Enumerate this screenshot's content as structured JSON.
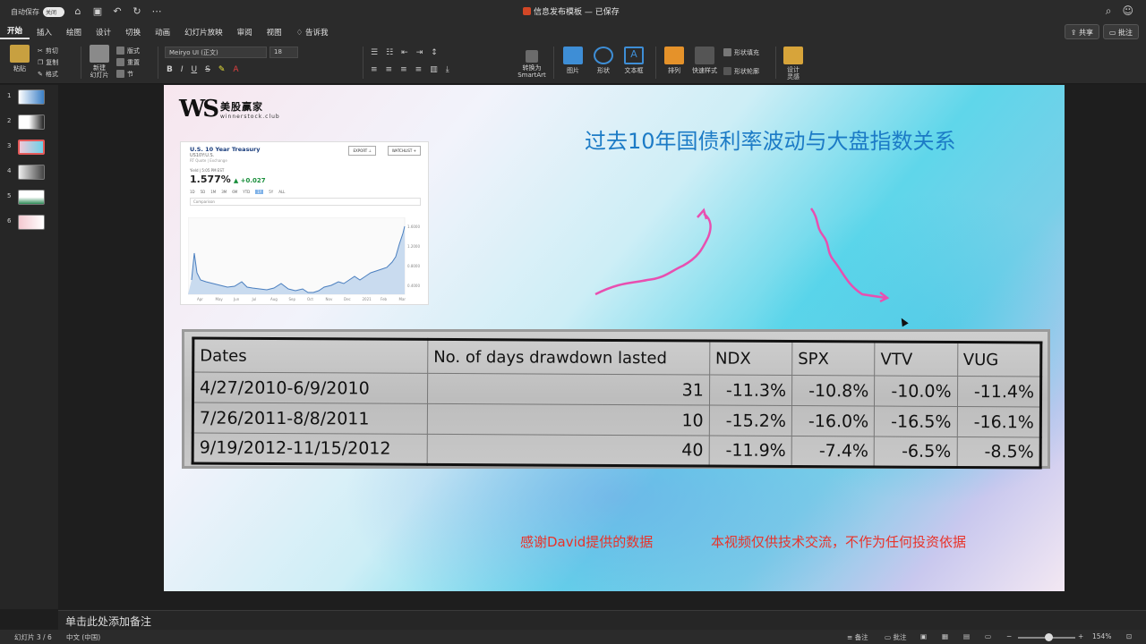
{
  "titlebar": {
    "autosave_label": "自动保存",
    "autosave_state": "关闭",
    "doc_title": "信息发布模板 — 已保存",
    "icons": [
      "home-icon",
      "save-icon",
      "undo-icon",
      "redo-icon",
      "more-icon",
      "search-icon",
      "people-icon"
    ]
  },
  "menu": {
    "tabs": [
      "开始",
      "插入",
      "绘图",
      "设计",
      "切换",
      "动画",
      "幻灯片放映",
      "审阅",
      "视图"
    ],
    "tell_me": "告诉我",
    "share": "共享",
    "comment": "批注"
  },
  "ribbon": {
    "paste": "粘贴",
    "cut": "剪切",
    "copy": "复制",
    "format": "格式",
    "new_slide": "新建\n幻灯片",
    "layout": "版式",
    "reset": "重置",
    "section": "节",
    "font": "Meiryo UI (正文)",
    "size": "18",
    "convert_smartart": "转换为\nSmartArt",
    "picture": "图片",
    "shape": "形状",
    "textbox": "文本框",
    "arrange": "排列",
    "quick_styles": "快速样式",
    "shape_fill": "形状填充",
    "shape_outline": "形状轮廓",
    "designer": "设计\n灵感"
  },
  "slides_panel": {
    "numbers": [
      "1",
      "2",
      "3",
      "4",
      "5",
      "6"
    ],
    "selected": 3
  },
  "slide": {
    "logo": {
      "mark": "WS",
      "cn": "美股赢家",
      "en": "winnerstock.club"
    },
    "title": "过去10年国债利率波动与大盘指数关系",
    "treasury": {
      "name": "U.S. 10 Year Treasury",
      "symbol": "US10Y:U.S.",
      "sub": "RT Quote | Exchange",
      "export": "EXPORT ⊥",
      "watchlist": "WATCHLIST +",
      "yield_label": "Yield | 5:05 PM EST",
      "yield": "1.577%",
      "change": "▲ +0.027",
      "ranges": [
        "1D",
        "5D",
        "1M",
        "3M",
        "6M",
        "YTD",
        "1Y",
        "5Y",
        "ALL"
      ],
      "range_selected": "1Y",
      "comparison": "Comparison",
      "x_labels": [
        "Apr",
        "May",
        "Jun",
        "Jul",
        "Aug",
        "Sep",
        "Oct",
        "Nov",
        "Dec",
        "2021",
        "Feb",
        "Mar"
      ],
      "y_labels": [
        "1.6000",
        "1.2000",
        "0.8000",
        "0.4000"
      ]
    },
    "table": {
      "headers": [
        "Dates",
        "No. of days drawdown lasted",
        "NDX",
        "SPX",
        "VTV",
        "VUG"
      ],
      "rows": [
        [
          "4/27/2010-6/9/2010",
          "31",
          "-11.3%",
          "-10.8%",
          "-10.0%",
          "-11.4%"
        ],
        [
          "7/26/2011-8/8/2011",
          "10",
          "-15.2%",
          "-16.0%",
          "-16.5%",
          "-16.1%"
        ],
        [
          "9/19/2012-11/15/2012",
          "40",
          "-11.9%",
          "-7.4%",
          "-6.5%",
          "-8.5%"
        ]
      ]
    },
    "credit_left": "感谢David提供的数据",
    "credit_right": "本视频仅供技术交流，不作为任何投资依据",
    "arrow_color": "#e84fb0",
    "title_color": "#1c7bc6",
    "credit_color": "#e8332a"
  },
  "notes_placeholder": "单击此处添加备注",
  "status": {
    "slide_of": "幻灯片 3 / 6",
    "lang": "中文 (中国)",
    "notes": "备注",
    "comments": "批注",
    "zoom": "154%"
  }
}
